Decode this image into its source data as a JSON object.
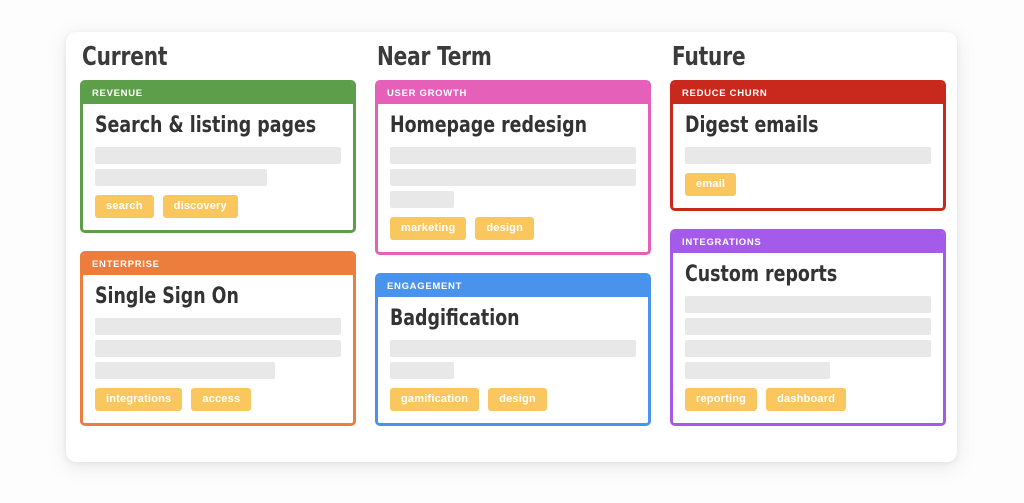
{
  "board": {
    "background_color": "#ffffff",
    "page_background": "#fdfdfd",
    "tag_color": "#fac75f",
    "skeleton_color": "#e8e8e8",
    "columns": [
      {
        "title": "Current",
        "cards": [
          {
            "label": "REVENUE",
            "color": "#5d9e4b",
            "title": "Search & listing pages",
            "skeleton_widths": [
              "100%",
              "70%"
            ],
            "tags": [
              "search",
              "discovery"
            ]
          },
          {
            "label": "ENTERPRISE",
            "color": "#ec7d3c",
            "title": "Single Sign On",
            "skeleton_widths": [
              "100%",
              "100%",
              "73%"
            ],
            "tags": [
              "integrations",
              "access"
            ]
          }
        ]
      },
      {
        "title": "Near Term",
        "cards": [
          {
            "label": "USER GROWTH",
            "color": "#e560b9",
            "title": "Homepage redesign",
            "skeleton_widths": [
              "100%",
              "100%",
              "26%"
            ],
            "tags": [
              "marketing",
              "design"
            ]
          },
          {
            "label": "ENGAGEMENT",
            "color": "#4a93ed",
            "title": "Badgification",
            "skeleton_widths": [
              "100%",
              "26%"
            ],
            "tags": [
              "gamification",
              "design"
            ]
          }
        ]
      },
      {
        "title": "Future",
        "cards": [
          {
            "label": "REDUCE CHURN",
            "color": "#c9291d",
            "title": "Digest emails",
            "skeleton_widths": [
              "100%"
            ],
            "tags": [
              "email"
            ]
          },
          {
            "label": "INTEGRATIONS",
            "color": "#a45bea",
            "title": "Custom reports",
            "skeleton_widths": [
              "100%",
              "100%",
              "100%",
              "59%"
            ],
            "tags": [
              "reporting",
              "dashboard"
            ]
          }
        ]
      }
    ]
  }
}
